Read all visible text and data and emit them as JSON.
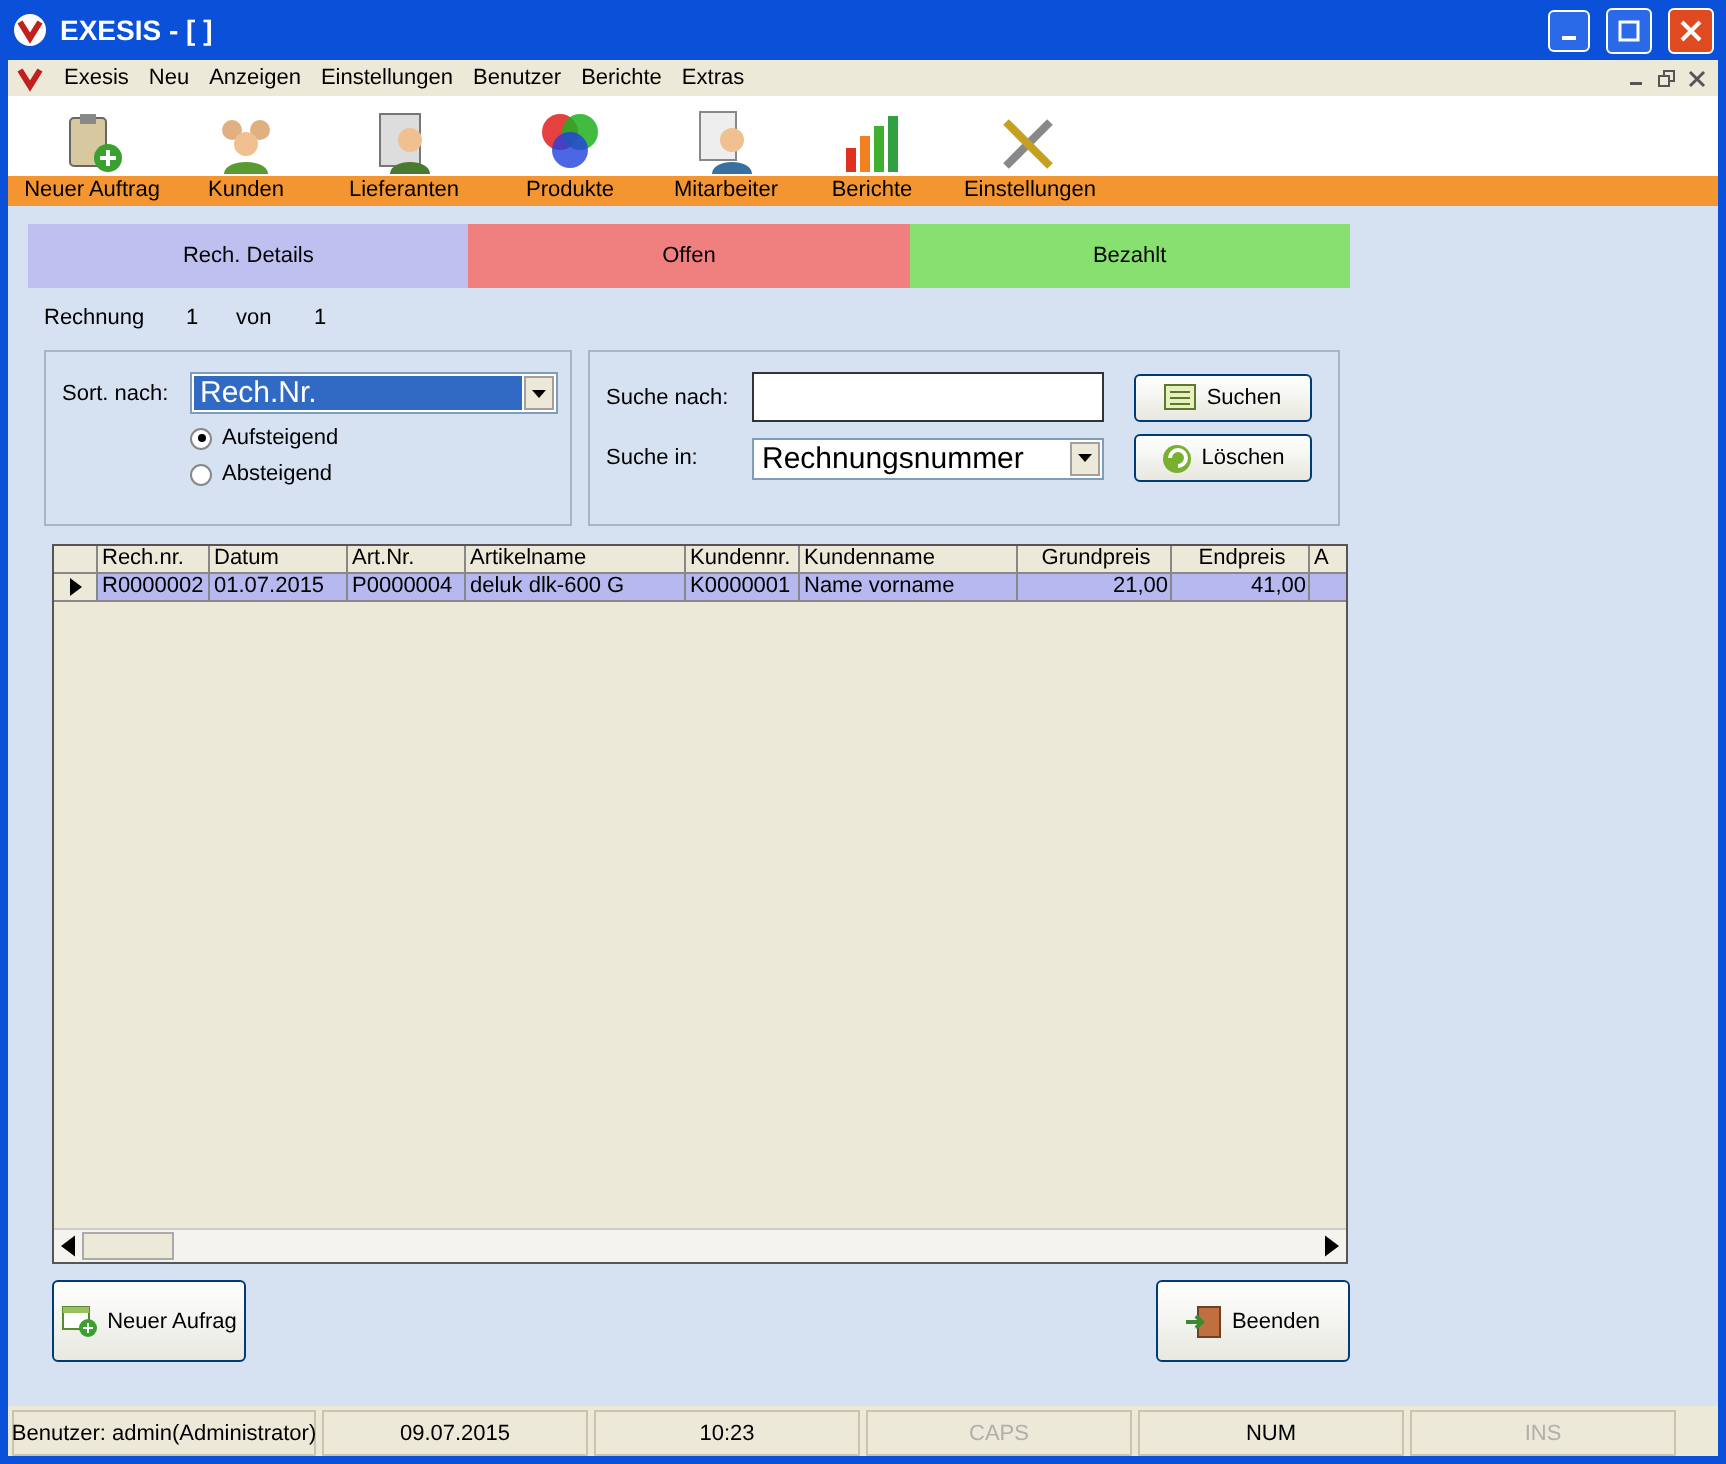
{
  "window": {
    "title": "EXESIS - [ ]"
  },
  "menu": [
    "Exesis",
    "Neu",
    "Anzeigen",
    "Einstellungen",
    "Benutzer",
    "Berichte",
    "Extras"
  ],
  "toolbar": [
    {
      "label": "Neuer Auftrag",
      "kind": "new"
    },
    {
      "label": "Kunden",
      "kind": "customers"
    },
    {
      "label": "Lieferanten",
      "kind": "supplier"
    },
    {
      "label": "Produkte",
      "kind": "products"
    },
    {
      "label": "Mitarbeiter",
      "kind": "staff"
    },
    {
      "label": "Berichte",
      "kind": "reports"
    },
    {
      "label": "Einstellungen",
      "kind": "settings"
    }
  ],
  "status_tabs": [
    {
      "label": "Rech. Details",
      "color": "#c0c0f0"
    },
    {
      "label": "Offen",
      "color": "#f08080"
    },
    {
      "label": "Bezahlt",
      "color": "#88e070"
    }
  ],
  "record": {
    "label": "Rechnung",
    "current": "1",
    "of": "von",
    "total": "1"
  },
  "sort": {
    "label": "Sort. nach:",
    "value": "Rech.Nr.",
    "options": [
      {
        "label": "Aufsteigend",
        "selected": true
      },
      {
        "label": "Absteigend",
        "selected": false
      }
    ]
  },
  "search": {
    "label": "Suche nach:",
    "in_label": "Suche in:",
    "in_value": "Rechnungsnummer",
    "search_button": "Suchen",
    "clear_button": "Löschen"
  },
  "table": {
    "columns": [
      {
        "label": "Rech.nr.",
        "kind": "text"
      },
      {
        "label": "Datum",
        "kind": "text"
      },
      {
        "label": "Art.Nr.",
        "kind": "text"
      },
      {
        "label": "Artikelname",
        "kind": "text"
      },
      {
        "label": "Kundennr.",
        "kind": "text"
      },
      {
        "label": "Kundenname",
        "kind": "text"
      },
      {
        "label": "Grundpreis",
        "kind": "number"
      },
      {
        "label": "Endpreis",
        "kind": "number"
      },
      {
        "label": "A",
        "kind": "text"
      }
    ],
    "rows": [
      {
        "selected": true,
        "cells": [
          "R0000002",
          "01.07.2015",
          "P0000004",
          "deluk dlk-600 G",
          "K0000001",
          "Name vorname",
          "21,00",
          "41,00"
        ]
      }
    ]
  },
  "buttons": {
    "new": "Neuer Aufrag",
    "quit": "Beenden"
  },
  "status_bar": [
    {
      "text": "Benutzer:  admin(Administrator)",
      "enabled": true
    },
    {
      "text": "09.07.2015",
      "enabled": true
    },
    {
      "text": "10:23",
      "enabled": true
    },
    {
      "text": "CAPS",
      "enabled": false
    },
    {
      "text": "NUM",
      "enabled": true
    },
    {
      "text": "INS",
      "enabled": false
    }
  ]
}
